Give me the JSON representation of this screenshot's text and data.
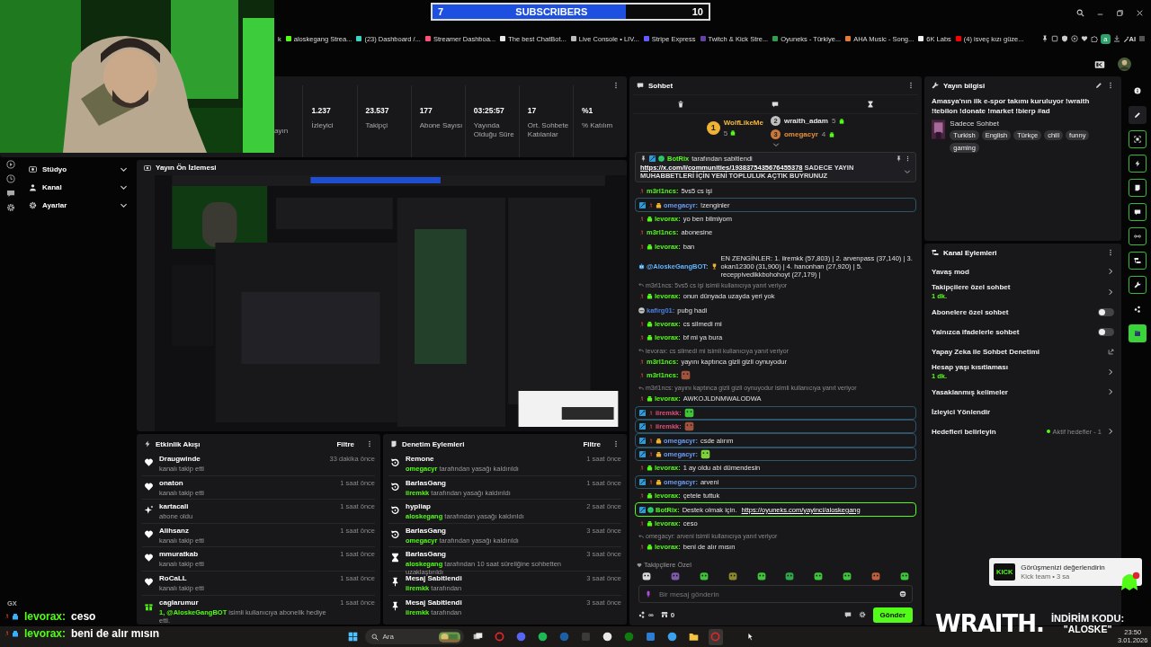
{
  "stream_widget": {
    "current": "7",
    "label": "SUBSCRIBERS",
    "target": "10",
    "level": 0.7
  },
  "browser": {
    "bookmarks": [
      {
        "label": "k"
      },
      {
        "label": "aloskegang Strea...",
        "color": "#53fc18"
      },
      {
        "label": "(23) Dashboard /...",
        "color": "#3ad4c0"
      },
      {
        "label": "Streamer Dashboa...",
        "color": "#ff4f7b"
      },
      {
        "label": "The best ChatBot...",
        "color": "#e8e8e8"
      },
      {
        "label": "Live Console • LIV...",
        "color": "#bbbbbb"
      },
      {
        "label": "Stripe Express",
        "color": "#635bff"
      },
      {
        "label": "Twitch & Kick Stre...",
        "color": "#6441a5"
      },
      {
        "label": "Oyuneks - Türkiye...",
        "color": "#2ea04a"
      },
      {
        "label": "AHA Music - Song...",
        "color": "#e07b39"
      },
      {
        "label": "6K Labs",
        "color": "#f0f0f0"
      },
      {
        "label": "(4) isveç kızı güze...",
        "color": "#ff0000"
      }
    ],
    "extension_badge": "a",
    "ai_label": "AI"
  },
  "stats": [
    {
      "label": "ayın"
    },
    {
      "value": "1.237",
      "label": "İzleyici"
    },
    {
      "value": "23.537",
      "label": "Takipçi"
    },
    {
      "value": "177",
      "label": "Abone Sayısı"
    },
    {
      "value": "03:25:57",
      "label": "Yayında Olduğu Süre"
    },
    {
      "value": "17",
      "label": "Ort. Sohbete Katılanlar"
    },
    {
      "value": "%1",
      "label": "% Katılım"
    }
  ],
  "rail_left": [
    {
      "kind": "play"
    },
    {
      "kind": "clock"
    },
    {
      "kind": "chat"
    },
    {
      "kind": "gear"
    }
  ],
  "sidebar": {
    "items": [
      {
        "label": "Stüdyo",
        "kind": "studio",
        "expanded": false
      },
      {
        "label": "Kanal",
        "kind": "channel",
        "expanded": false
      },
      {
        "label": "Ayarlar",
        "kind": "settings",
        "expanded": false
      }
    ]
  },
  "preview": {
    "title": "Yayın Ön İzlemesi"
  },
  "activity": {
    "title": "Etkinlik Akışı",
    "filter": "Filtre",
    "events": [
      {
        "kind": "follow",
        "user": "Draugwinde",
        "action": "kanalı takip etti",
        "time": "33 dakika önce"
      },
      {
        "kind": "follow",
        "user": "onaton",
        "action": "kanalı takip etti",
        "time": "1 saat önce"
      },
      {
        "kind": "subscribe",
        "user": "kartacali",
        "action": "abone oldu",
        "time": "1 saat önce"
      },
      {
        "kind": "follow",
        "user": "Alihsanz",
        "action": "kanalı takip etti",
        "time": "1 saat önce"
      },
      {
        "kind": "follow",
        "user": "mmuratkab",
        "action": "kanalı takip etti",
        "time": "1 saat önce"
      },
      {
        "kind": "follow",
        "user": "RoCaLL",
        "action": "kanalı takip etti",
        "time": "1 saat önce"
      },
      {
        "kind": "gift",
        "user": "caglarumur",
        "highlight": "1, @AloskeGangBOT",
        "action": "isimli kullanıcıya abonelik hediye etti.",
        "time": "1 saat önce"
      }
    ]
  },
  "moderation": {
    "title": "Denetim Eylemleri",
    "filter": "Filtre",
    "actions": [
      {
        "kind": "unban",
        "target": "Remone",
        "moderator": "omegacyr",
        "action": "tarafından yasağı kaldırıldı",
        "time": "1 saat önce"
      },
      {
        "kind": "unban",
        "target": "BarlasGang",
        "moderator": "iiremkk",
        "action": "tarafından yasağı kaldırıldı",
        "time": "1 saat önce"
      },
      {
        "kind": "unban",
        "target": "hypliap",
        "moderator": "aloskegang",
        "action": "tarafından yasağı kaldırıldı",
        "time": "2 saat önce"
      },
      {
        "kind": "unban",
        "target": "BarlasGang",
        "moderator": "omegacyr",
        "action": "tarafından yasağı kaldırıldı",
        "time": "3 saat önce"
      },
      {
        "kind": "timeout",
        "target": "BarlasGang",
        "moderator": "aloskegang",
        "action": "tarafından 10 saat süreliğine sohbetten uzaklaştırıldı",
        "time": "3 saat önce"
      },
      {
        "kind": "pin",
        "target": "Mesaj Sabitlendi",
        "moderator": "iiremkk",
        "action": "tarafından",
        "time": "3 saat önce"
      },
      {
        "kind": "pin",
        "target": "Mesaj Sabitlendi",
        "moderator": "iiremkk",
        "action": "tarafından",
        "time": "3 saat önce"
      }
    ]
  },
  "chat": {
    "title": "Sohbet",
    "leaders": [
      {
        "rank": "1",
        "name": "WolfLikeMe",
        "count": "5",
        "color": "#f5b83d"
      },
      {
        "rank": "2",
        "name": "wraith_adam",
        "count": "5",
        "color": "#e6e6e6"
      },
      {
        "rank": "3",
        "name": "omegacyr",
        "count": "4",
        "color": "#e8913a"
      }
    ],
    "pinned": {
      "badges": [
        {
          "kind": "moderator"
        },
        {
          "kind": "verified"
        }
      ],
      "by": "BotRix",
      "note": "tarafından sabitlendi",
      "link": "https://x.com/i/communities/1938375435676455378",
      "text": "SADECE YAYIN MUHABBETLERİ İÇİN YENİ TOPLULUK AÇTIK BUYRUNUZ"
    },
    "messages": [
      {
        "kind": "message",
        "badges": [
          {
            "kind": "tenure"
          }
        ],
        "user": "m3rl1ncs:",
        "color": "#53fc18",
        "text": "5vs5 cs işi"
      },
      {
        "kind": "mod_message",
        "badges": [
          {
            "kind": "moderator"
          },
          {
            "kind": "tenure"
          },
          {
            "kind": "gifter"
          }
        ],
        "user": "omegacyr:",
        "color": "#6a9cf5",
        "text": "!zenginler"
      },
      {
        "kind": "message",
        "badges": [
          {
            "kind": "tenure"
          },
          {
            "kind": "subscriber"
          }
        ],
        "user": "levorax:",
        "color": "#53fc18",
        "text": "yo ben bilmiyom"
      },
      {
        "kind": "message",
        "badges": [
          {
            "kind": "tenure"
          }
        ],
        "user": "m3rl1ncs:",
        "color": "#53fc18",
        "text": "abonesine"
      },
      {
        "kind": "message",
        "badges": [
          {
            "kind": "tenure"
          },
          {
            "kind": "subscriber"
          }
        ],
        "user": "levorax:",
        "color": "#53fc18",
        "text": "ban"
      },
      {
        "kind": "message",
        "badges": [
          {
            "kind": "bot"
          }
        ],
        "user": "@AloskeGangBOT:",
        "color": "#5fb4ff",
        "emblem": {
          "kind": "trophy"
        },
        "text": "EN ZENGİNLER: 1. iiremkk (57,803) | 2. arvenpass (37,140) | 3. okan12300 (31,900) | 4. hanonhan (27,920) | 5. receppivedikkbohohoyt (27,179) |"
      },
      {
        "kind": "reply",
        "text": "m3rl1ncs: 5vs5 cs işi isimli kullanıcıya yanıt veriyor"
      },
      {
        "kind": "message",
        "badges": [
          {
            "kind": "tenure"
          },
          {
            "kind": "subscriber"
          }
        ],
        "user": "levorax:",
        "color": "#53fc18",
        "text": "onun dünyada uzayda yeri yok"
      },
      {
        "kind": "message",
        "badges": [
          {
            "kind": "avatar"
          }
        ],
        "user": "kafirg01:",
        "color": "#4d7fe0",
        "text": "pubg hadi"
      },
      {
        "kind": "message",
        "badges": [
          {
            "kind": "tenure"
          },
          {
            "kind": "subscriber"
          }
        ],
        "user": "levorax:",
        "color": "#53fc18",
        "text": "cs silmedi mi"
      },
      {
        "kind": "message",
        "badges": [
          {
            "kind": "tenure"
          },
          {
            "kind": "subscriber"
          }
        ],
        "user": "levorax:",
        "color": "#53fc18",
        "text": "bf mi ya bura"
      },
      {
        "kind": "reply",
        "text": "levorax: cs silmedi mi isimli kullanıcıya yanıt veriyor"
      },
      {
        "kind": "message",
        "badges": [
          {
            "kind": "tenure"
          }
        ],
        "user": "m3rl1ncs:",
        "color": "#53fc18",
        "text": "yayını kaptınca gizli gizli oynuyodur"
      },
      {
        "kind": "message",
        "badges": [
          {
            "kind": "tenure"
          }
        ],
        "user": "m3rl1ncs:",
        "color": "#53fc18",
        "emote": {
          "color": "#a0523d"
        }
      },
      {
        "kind": "reply",
        "text": "m3rl1ncs: yayını kaptınca gizli gizli oynuyodur isimli kullanıcıya yanıt veriyor"
      },
      {
        "kind": "message",
        "badges": [
          {
            "kind": "tenure"
          },
          {
            "kind": "subscriber"
          }
        ],
        "user": "levorax:",
        "color": "#53fc18",
        "text": "AWKOJLDNMWALODWA"
      },
      {
        "kind": "mod_message",
        "badges": [
          {
            "kind": "moderator"
          },
          {
            "kind": "tenure"
          }
        ],
        "user": "iiremkk:",
        "color": "#e0507a",
        "emote": {
          "color": "#3fc43a"
        }
      },
      {
        "kind": "mod_message",
        "badges": [
          {
            "kind": "moderator"
          },
          {
            "kind": "tenure"
          }
        ],
        "user": "iiremkk:",
        "color": "#e0507a",
        "emote": {
          "color": "#a0523d"
        }
      },
      {
        "kind": "mod_message",
        "badges": [
          {
            "kind": "moderator"
          },
          {
            "kind": "tenure"
          },
          {
            "kind": "gifter"
          }
        ],
        "user": "omegacyr:",
        "color": "#6a9cf5",
        "text": "csde alırım"
      },
      {
        "kind": "mod_message",
        "badges": [
          {
            "kind": "moderator"
          },
          {
            "kind": "tenure"
          },
          {
            "kind": "gifter"
          }
        ],
        "user": "omegacyr:",
        "color": "#6a9cf5",
        "emote": {
          "color": "#7fd13b"
        }
      },
      {
        "kind": "message",
        "badges": [
          {
            "kind": "tenure"
          },
          {
            "kind": "subscriber"
          }
        ],
        "user": "levorax:",
        "color": "#53fc18",
        "text": "1 ay oldu abi dümendesin"
      },
      {
        "kind": "mod_message",
        "badges": [
          {
            "kind": "moderator"
          },
          {
            "kind": "tenure"
          },
          {
            "kind": "gifter"
          }
        ],
        "user": "omegacyr:",
        "color": "#6a9cf5",
        "text": "arveni"
      },
      {
        "kind": "message",
        "badges": [
          {
            "kind": "tenure"
          },
          {
            "kind": "subscriber"
          }
        ],
        "user": "levorax:",
        "color": "#53fc18",
        "text": "çetele tuttuk"
      },
      {
        "kind": "bot_message",
        "badges": [
          {
            "kind": "moderator"
          },
          {
            "kind": "verified"
          }
        ],
        "user": "BotRix:",
        "color": "#53fc18",
        "text": "Destek olmak için.",
        "link": "https://oyuneks.com/yayinci/aloskegang"
      },
      {
        "kind": "message",
        "badges": [
          {
            "kind": "tenure"
          },
          {
            "kind": "subscriber"
          }
        ],
        "user": "levorax:",
        "color": "#53fc18",
        "text": "ceso"
      },
      {
        "kind": "reply",
        "text": "omegacyr: arveni isimli kullanıcıya yanıt veriyor"
      },
      {
        "kind": "message",
        "badges": [
          {
            "kind": "tenure"
          },
          {
            "kind": "subscriber"
          }
        ],
        "user": "levorax:",
        "color": "#53fc18",
        "text": "beni de alır mısın"
      }
    ],
    "emote_bar": {
      "label": "Takipçilere Özel",
      "emotes": [
        {
          "color": "#d9d9d9"
        },
        {
          "color": "#7e5aa8"
        },
        {
          "color": "#3fc43a"
        },
        {
          "color": "#8a8a2a"
        },
        {
          "color": "#3fc43a"
        },
        {
          "color": "#2fa84a"
        },
        {
          "color": "#3fc43a"
        },
        {
          "color": "#3fc43a"
        },
        {
          "color": "#c0603a"
        },
        {
          "color": "#3fc43a"
        }
      ]
    },
    "input": {
      "placeholder": "Bir mesaj gönderin"
    },
    "points": "∞",
    "store_count": "0",
    "send": "Gönder"
  },
  "stream_info": {
    "heading": "Yayın bilgisi",
    "title": "Amasya'nın ilk e-spor takımı kuruluyor !wraith !tebilon !donate !market !bierp #ad",
    "category": "Sadece Sohbet",
    "tags": [
      "Turkish",
      "English",
      "Türkçe",
      "chill",
      "funny",
      "gaming"
    ]
  },
  "channel_actions": {
    "heading": "Kanal Eylemleri",
    "items": [
      {
        "kind": "link",
        "label": "Yavaş mod"
      },
      {
        "kind": "link",
        "label": "Takipçilere özel sohbet",
        "detail": "1 dk."
      },
      {
        "kind": "toggle",
        "label": "Abonelere özel sohbet",
        "on": false
      },
      {
        "kind": "toggle",
        "label": "Yalnızca ifadelerle sohbet",
        "on": false
      },
      {
        "kind": "external",
        "label": "Yapay Zeka ile Sohbet Denetimi"
      },
      {
        "kind": "link",
        "label": "Hesap yaşı kısıtlaması",
        "detail": "1 dk."
      },
      {
        "kind": "link",
        "label": "Yasaklanmış kelimeler"
      },
      {
        "kind": "plain",
        "label": "İzleyici Yönlendir"
      },
      {
        "kind": "link",
        "label": "Hedefleri belirleyin",
        "status": "Aktif hedefler - 1"
      }
    ]
  },
  "rail_right": [
    {
      "kind": "info"
    },
    {
      "kind": "edit"
    },
    {
      "kind": "focus"
    },
    {
      "kind": "bolt"
    },
    {
      "kind": "note"
    },
    {
      "kind": "chat"
    },
    {
      "kind": "link"
    },
    {
      "kind": "panel"
    },
    {
      "kind": "wrench"
    },
    {
      "kind": "nodes"
    },
    {
      "kind": "clip"
    }
  ],
  "stream_overlay": {
    "tag": "GX",
    "lines": [
      {
        "user": "levorax:",
        "text": "ceso"
      },
      {
        "user": "levorax:",
        "text": "beni de alır mısın"
      }
    ]
  },
  "notification": {
    "logo": "KICK",
    "title": "Görüşmenizi değerlendirin",
    "detail": "Kick team • 3 sa"
  },
  "ad": {
    "brand": "WRAITH.",
    "label": "İNDİRİM KODU:",
    "code": "\"ALOSKE\""
  },
  "taskbar": {
    "search": "Ara",
    "apps": [
      {
        "kind": "task_view",
        "selected": false
      },
      {
        "kind": "ring",
        "color": "#e0242b",
        "selected": false
      },
      {
        "kind": "round",
        "color": "#5865f2",
        "selected": false
      },
      {
        "kind": "round",
        "color": "#1db954",
        "selected": false
      },
      {
        "kind": "round",
        "color": "#1b5fa8",
        "selected": false
      },
      {
        "kind": "square",
        "color": "#3a3a3a",
        "selected": false
      },
      {
        "kind": "round",
        "color": "#e8e8e8",
        "selected": false
      },
      {
        "kind": "round",
        "color": "#107c10",
        "selected": false
      },
      {
        "kind": "square",
        "color": "#2d7dd2",
        "selected": false
      },
      {
        "kind": "round",
        "color": "#3aa0f0",
        "selected": false
      },
      {
        "kind": "folder",
        "color": "#f5c342",
        "selected": false
      },
      {
        "kind": "ring",
        "color": "#e0242b",
        "selected": true
      }
    ],
    "time": "23:50",
    "date": "3.01.2026"
  }
}
